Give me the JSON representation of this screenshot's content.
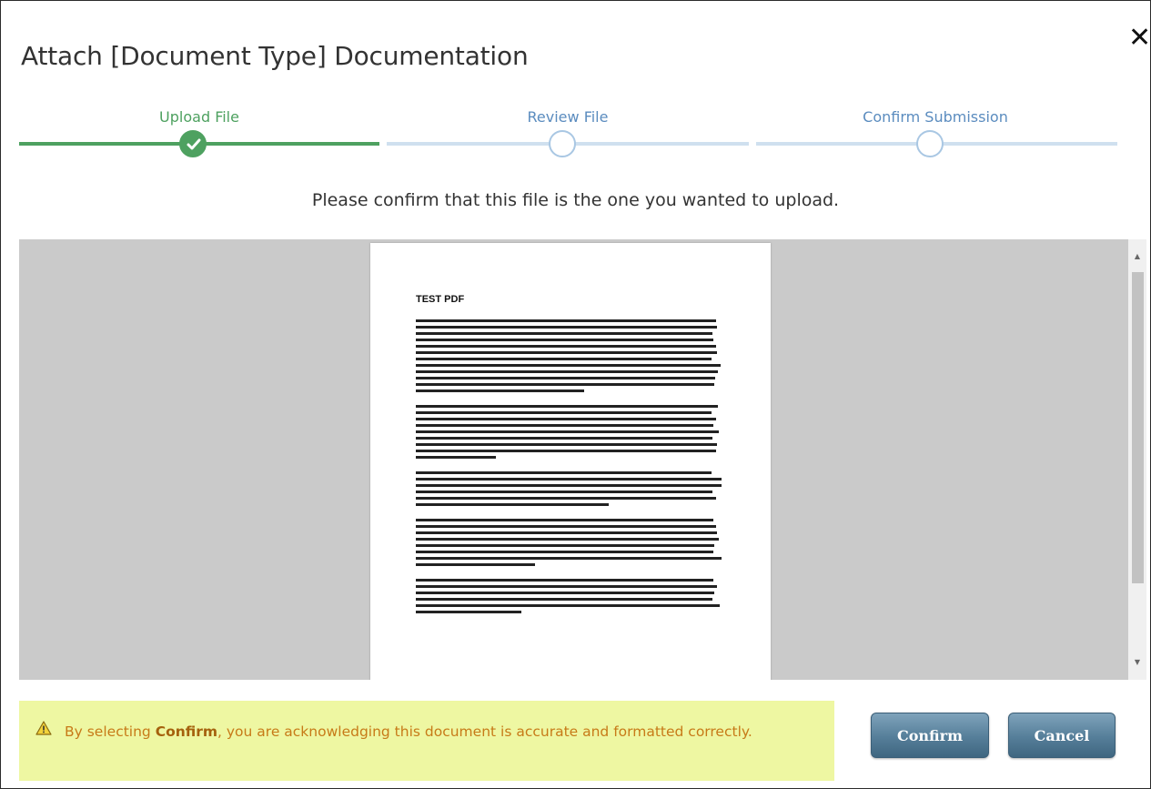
{
  "dialog": {
    "title": "Attach [Document Type] Documentation",
    "close_glyph": "✕"
  },
  "stepper": {
    "steps": [
      {
        "label": "Upload File",
        "state": "complete"
      },
      {
        "label": "Review File",
        "state": "pending"
      },
      {
        "label": "Confirm Submission",
        "state": "pending"
      }
    ],
    "colors": {
      "complete": "#4ea160",
      "pending": "#a9c7e3",
      "label": "#5b8cbf"
    }
  },
  "prompt": "Please confirm that this file is the one you wanted to upload.",
  "preview": {
    "document_title": "TEST PDF",
    "background": "#cacaca"
  },
  "notice": {
    "icon": "warning-icon",
    "text_before": "By selecting ",
    "text_bold": "Confirm",
    "text_after": ", you are acknowledging this document is accurate and formatted correctly.",
    "background": "#eef7a2",
    "color": "#c77a18"
  },
  "buttons": {
    "confirm_label": "Confirm",
    "cancel_label": "Cancel"
  }
}
